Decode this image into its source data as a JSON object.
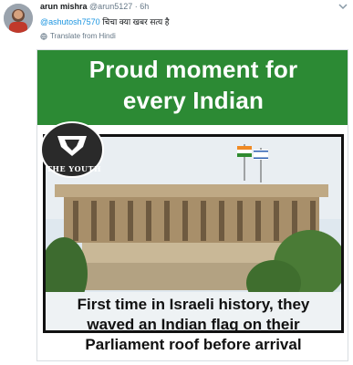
{
  "tweet": {
    "author_name": "arun mishra",
    "author_handle": "@arun5127",
    "separator": "·",
    "time": "6h",
    "mention": "@ashutosh7570",
    "text": "चिचा क्या खबर सत्य है",
    "translate_label": "Translate from Hindi"
  },
  "image": {
    "headline_line1": "Proud moment for",
    "headline_line2": "every Indian",
    "logo_text": "THE YOUTH",
    "caption_line1": "First time in Israeli history, they",
    "caption_line2": "waved an Indian flag on their",
    "caption_line3": "Parliament roof before arrival"
  },
  "colors": {
    "banner_green": "#2c8a34",
    "mention_blue": "#1b95e0",
    "meta_gray": "#657786"
  },
  "icons": [
    "avatar",
    "chevron-down-icon",
    "globe-icon"
  ]
}
